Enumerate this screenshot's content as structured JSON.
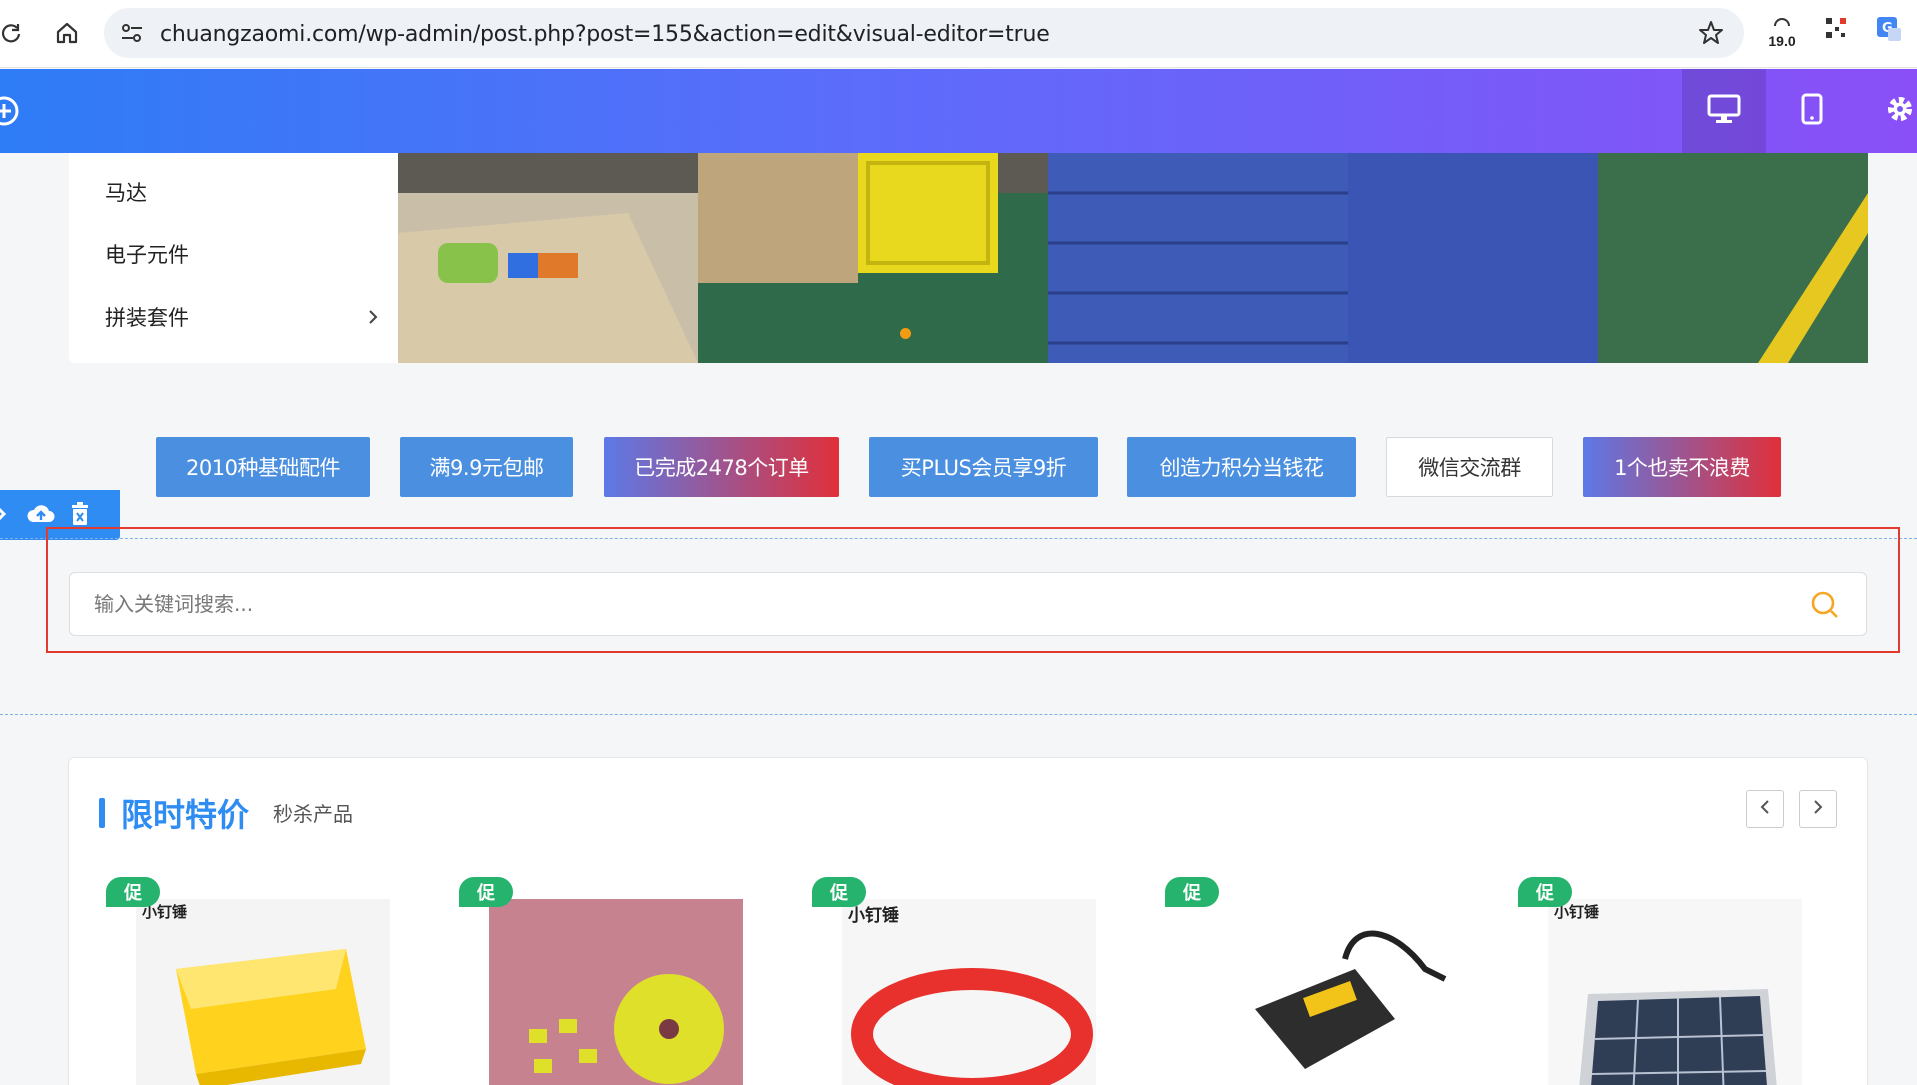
{
  "browser": {
    "url": "chuangzaomi.com/wp-admin/post.php?post=155&action=edit&visual-editor=true",
    "speed_value": "19.0"
  },
  "editor": {
    "icons": [
      "add-icon",
      "desktop-icon",
      "mobile-icon",
      "gear-icon"
    ]
  },
  "side_menu": {
    "items": [
      {
        "label": "马达"
      },
      {
        "label": "电子元件"
      },
      {
        "label": "拼装套件"
      }
    ]
  },
  "promo_tags": [
    {
      "label": "2010种基础配件",
      "style": "blue"
    },
    {
      "label": "满9.9元包邮",
      "style": "blue"
    },
    {
      "label": "已完成2478个订单",
      "style": "gradient"
    },
    {
      "label": "买PLUS会员享9折",
      "style": "blue"
    },
    {
      "label": "创造力积分当钱花",
      "style": "blue"
    },
    {
      "label": "微信交流群",
      "style": "white"
    },
    {
      "label": "1个也卖不浪费",
      "style": "gradient"
    }
  ],
  "search": {
    "placeholder": "输入关键词搜索..."
  },
  "flash_sale": {
    "title": "限时特价",
    "subtitle": "秒杀产品",
    "badge": "促",
    "products": [
      {
        "brand": "小钉锤",
        "image": "yellow plastic tray"
      },
      {
        "brand": "",
        "image": "yellow foam wheels"
      },
      {
        "brand": "小钉锤",
        "image": "red rubber belt"
      },
      {
        "brand": "",
        "image": "battery charger"
      },
      {
        "brand": "小钉锤",
        "image": "solar panel"
      }
    ]
  },
  "colors": {
    "accent": "#2f8cf3",
    "sale_badge": "#26b36d",
    "selection": "#e33a2f"
  }
}
